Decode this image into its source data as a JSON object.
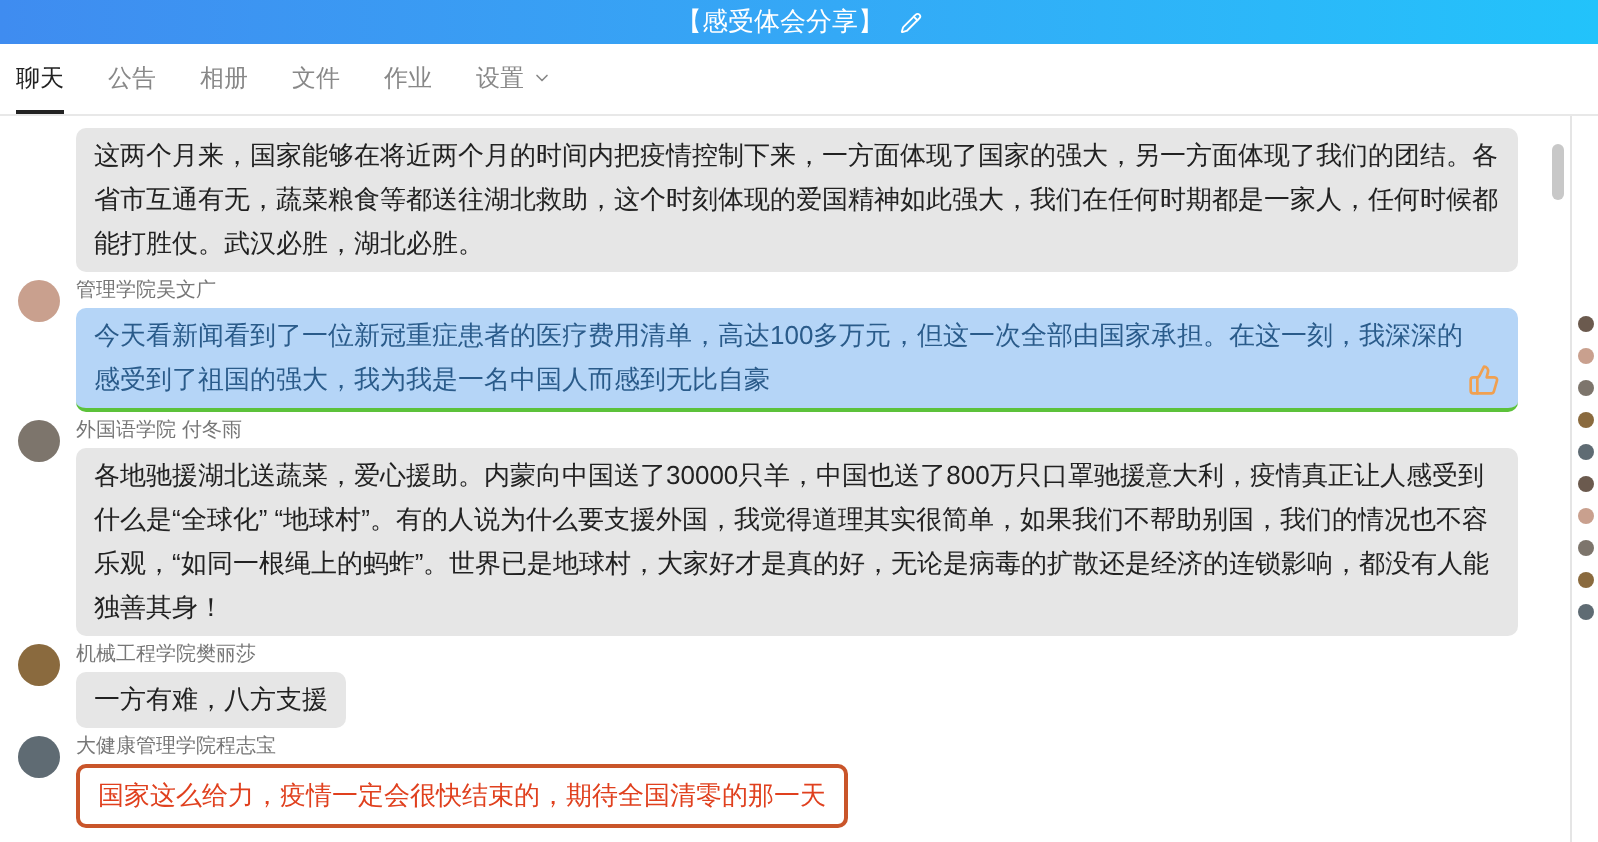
{
  "window": {
    "title": "【感受体会分享】"
  },
  "tabs": [
    {
      "label": "聊天",
      "selected": true,
      "dropdown": false
    },
    {
      "label": "公告",
      "selected": false,
      "dropdown": false
    },
    {
      "label": "相册",
      "selected": false,
      "dropdown": false
    },
    {
      "label": "文件",
      "selected": false,
      "dropdown": false
    },
    {
      "label": "作业",
      "selected": false,
      "dropdown": false
    },
    {
      "label": "设置",
      "selected": false,
      "dropdown": true
    }
  ],
  "messages": [
    {
      "kind": "plain",
      "text": "这两个月来，国家能够在将近两个月的时间内把疫情控制下来，一方面体现了国家的强大，另一方面体现了我们的团结。各省市互通有无，蔬菜粮食等都送往湖北救助，这个时刻体现的爱国精神如此强大，我们在任何时期都是一家人，任何时候都能打胜仗。武汉必胜，湖北必胜。",
      "thumbs_up": false
    },
    {
      "kind": "theme",
      "sender": "管理学院吴文广",
      "text": "今天看新闻看到了一位新冠重症患者的医疗费用清单，高达100多万元，但这一次全部由国家承担。在这一刻，我深深的感受到了祖国的强大，我为我是一名中国人而感到无比自豪",
      "thumbs_up": true
    },
    {
      "kind": "plain",
      "sender": "外国语学院 付冬雨",
      "text": "各地驰援湖北送蔬菜，爱心援助。内蒙向中国送了30000只羊，中国也送了800万只口罩驰援意大利，疫情真正让人感受到什么是“全球化” “地球村”。有的人说为什么要支援外国，我觉得道理其实很简单，如果我们不帮助别国，我们的情况也不容乐观，“如同一根绳上的蚂蚱”。世界已是地球村，大家好才是真的好，无论是病毒的扩散还是经济的连锁影响，都没有人能独善其身！",
      "thumbs_up": false
    },
    {
      "kind": "plain",
      "sender": "机械工程学院樊丽莎",
      "text": "一方有难，八方支援",
      "thumbs_up": false
    },
    {
      "kind": "bordered",
      "sender": "大健康管理学院程志宝",
      "text": "国家这么给力，疫情一定会很快结束的，期待全国清零的那一天",
      "thumbs_up": false
    }
  ]
}
